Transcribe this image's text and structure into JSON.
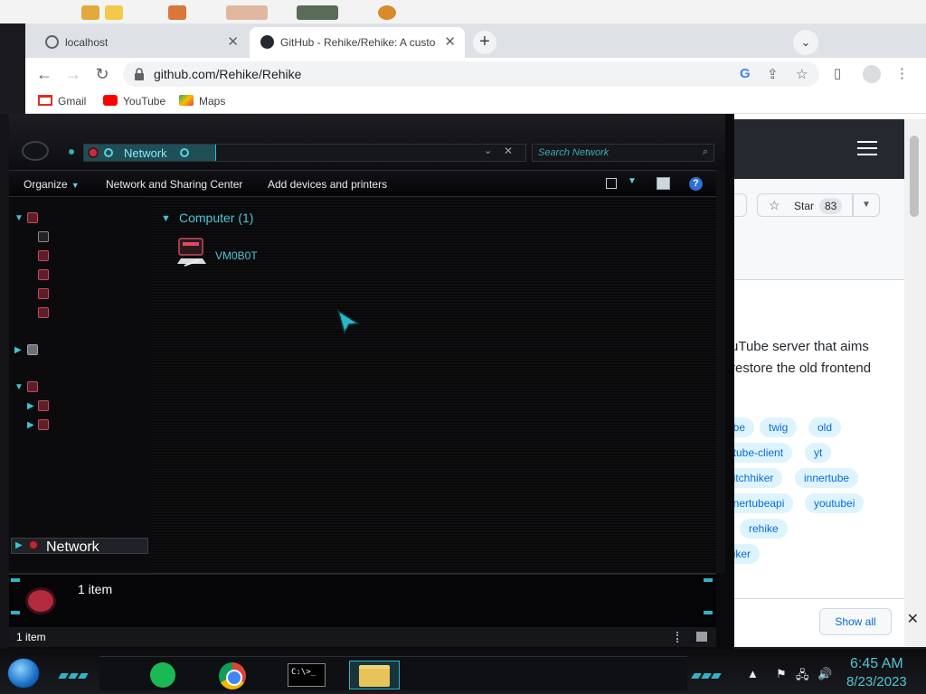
{
  "browser": {
    "tabs": [
      {
        "title": "localhost"
      },
      {
        "title": "GitHub - Rehike/Rehike: A custo"
      }
    ],
    "new_tab_symbol": "+",
    "address": "github.com/Rehike/Rehike",
    "bookmarks": [
      {
        "label": "Gmail",
        "icon": "gmail-icon"
      },
      {
        "label": "YouTube",
        "icon": "youtube-icon"
      },
      {
        "label": "Maps",
        "icon": "maps-icon"
      }
    ]
  },
  "github": {
    "star_label": "Star",
    "star_count": "83",
    "description": "uTube server that aims restore the old frontend",
    "topics": [
      "ube",
      "twig",
      "old",
      "utube-client",
      "yt",
      "hitchhiker",
      "innertube",
      "nnertubeapi",
      "youtubei",
      "rehike",
      "hiker"
    ],
    "show_all": "Show all"
  },
  "explorer": {
    "breadcrumb": "Network",
    "search_placeholder": "Search Network",
    "commands": {
      "organize": "Organize",
      "network_center": "Network and Sharing Center",
      "add_devices": "Add devices and printers"
    },
    "nav": {
      "selected": "Network"
    },
    "group_title": "Computer (1)",
    "items": [
      {
        "name": "VM0B0T"
      }
    ],
    "details_text": "1 item",
    "status_text": "1 item"
  },
  "taskbar": {
    "time": "6:45 AM",
    "date": "8/23/2023",
    "cmd_label": "C:\\>_"
  },
  "colors": {
    "accent": "#2fb4c7",
    "accent_text": "#4ec6d6",
    "github_dark": "#24292f",
    "topic_bg": "#ddf4ff",
    "topic_text": "#0969da"
  }
}
